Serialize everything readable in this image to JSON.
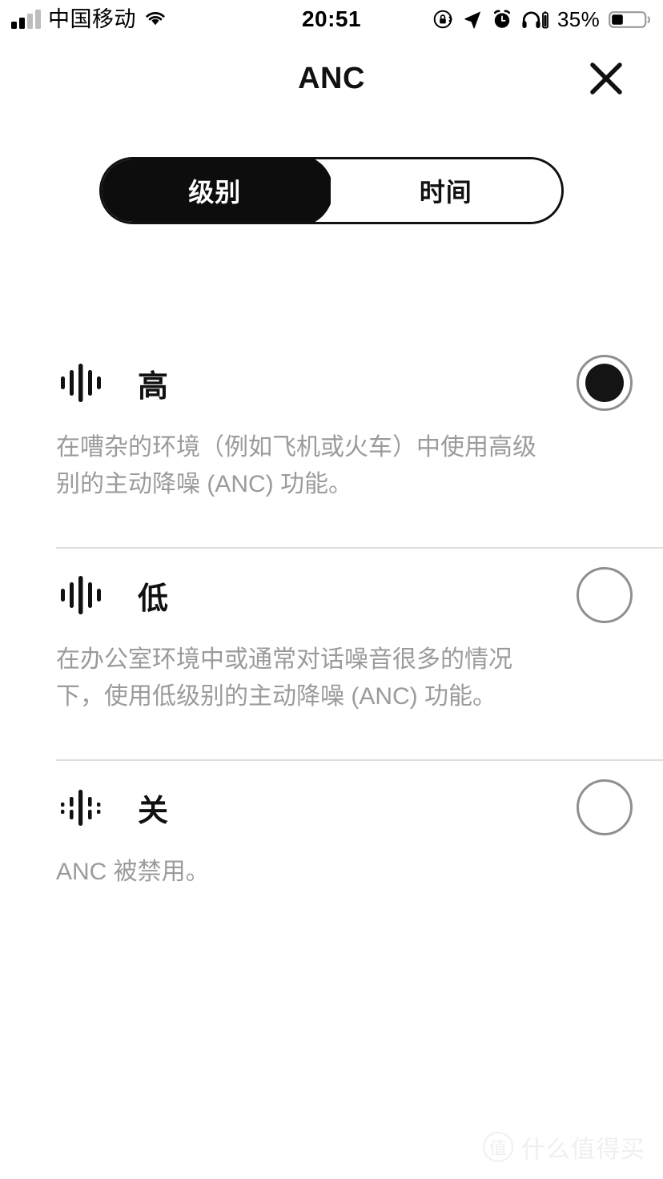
{
  "status_bar": {
    "carrier": "中国移动",
    "time": "20:51",
    "battery_percent": "35%",
    "icons": [
      "signal-bars-icon",
      "wifi-icon",
      "rotation-lock-icon",
      "location-arrow-icon",
      "alarm-clock-icon",
      "headphones-battery-icon",
      "battery-icon"
    ]
  },
  "header": {
    "title": "ANC",
    "close_icon": "close-x-icon"
  },
  "segmented_control": {
    "selected_index": 0,
    "tabs": [
      {
        "label": "级别",
        "active": true
      },
      {
        "label": "时间",
        "active": false
      }
    ]
  },
  "options": [
    {
      "label": "高",
      "icon": "anc-wave-on-icon",
      "selected": true,
      "description": "在嘈杂的环境（例如飞机或火车）中使用高级别的主动降噪 (ANC) 功能。"
    },
    {
      "label": "低",
      "icon": "anc-wave-on-icon",
      "selected": false,
      "description": "在办公室环境中或通常对话噪音很多的情况下，使用低级别的主动降噪 (ANC) 功能。"
    },
    {
      "label": "关",
      "icon": "anc-wave-off-icon",
      "selected": false,
      "description": "ANC 被禁用。"
    }
  ],
  "watermark": {
    "badge": "值",
    "text": "什么值得买"
  },
  "colors": {
    "accent": "#0d0d0d",
    "text_primary": "#111111",
    "text_secondary": "#9b9b9b",
    "divider": "#dedede",
    "radio_border": "#8f8f8f",
    "background": "#ffffff"
  }
}
